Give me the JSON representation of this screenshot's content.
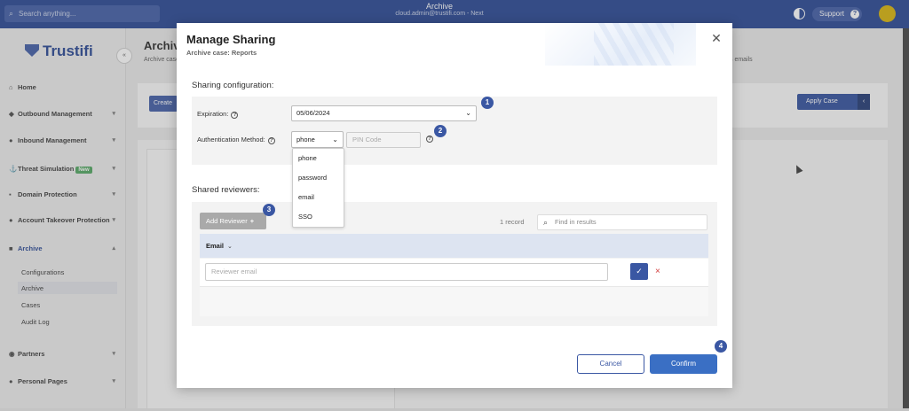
{
  "topbar": {
    "search_placeholder": "Search anything...",
    "center_title": "Archive",
    "center_subtitle": "cloud.admin@trustifi.com - Next",
    "support_label": "Support",
    "support_q": "?"
  },
  "sidebar": {
    "logo_text": "Trustifi",
    "collapse": "«",
    "items": [
      {
        "label": "Home"
      },
      {
        "label": "Outbound Management"
      },
      {
        "label": "Inbound Management"
      },
      {
        "label": "Threat Simulation",
        "badge": "New"
      },
      {
        "label": "Domain Protection"
      },
      {
        "label": "Account Takeover Protection"
      },
      {
        "label": "Archive"
      },
      {
        "label": "Partners"
      },
      {
        "label": "Personal Pages"
      }
    ],
    "archive_sub": [
      "Configurations",
      "Archive",
      "Cases",
      "Audit Log"
    ]
  },
  "main": {
    "title": "Archive",
    "subtitle": "Archive cases",
    "right_text": "s emails",
    "create_label": "Create",
    "apply_case_label": "Apply Case",
    "apply_case_arrow": "‹"
  },
  "modal": {
    "title": "Manage Sharing",
    "subtitle": "Archive case: Reports",
    "close": "✕",
    "sharing_config_title": "Sharing configuration:",
    "expiration_label": "Expiration:",
    "expiration_value": "05/06/2024",
    "auth_method_label": "Authentication Method:",
    "auth_method_value": "phone",
    "pin_placeholder": "PIN Code",
    "auth_options": [
      "phone",
      "password",
      "email",
      "SSO"
    ],
    "help": "?",
    "shared_reviewers_title": "Shared reviewers:",
    "add_reviewer_label": "Add Reviewer",
    "add_reviewer_plus": "+",
    "record_count": "1 record",
    "find_placeholder": "Find in results",
    "column_email": "Email",
    "reviewer_email_placeholder": "Reviewer email",
    "ok_glyph": "✓",
    "remove_glyph": "×",
    "cancel_label": "Cancel",
    "confirm_label": "Confirm"
  },
  "step_badges": [
    "1",
    "2",
    "3",
    "4"
  ],
  "colors": {
    "primary": "#3a57a3",
    "topbar": "#1f3f8f",
    "confirm": "#3a6fc4",
    "remove": "#d23c3c"
  }
}
